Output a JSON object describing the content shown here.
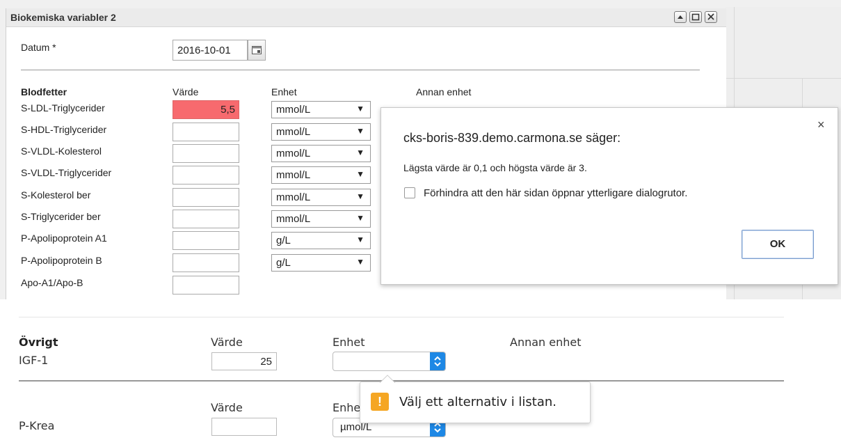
{
  "window": {
    "title": "Biokemiska variabler 2"
  },
  "date": {
    "label": "Datum *",
    "value": "2016-10-01"
  },
  "blood_lipids": {
    "heading": "Blodfetter",
    "col_value": "Värde",
    "col_unit": "Enhet",
    "col_other_unit": "Annan enhet",
    "rows": [
      {
        "label": "S-LDL-Triglycerider",
        "value": "5,5",
        "unit": "mmol/L"
      },
      {
        "label": "S-HDL-Triglycerider",
        "value": "",
        "unit": "mmol/L"
      },
      {
        "label": "S-VLDL-Kolesterol",
        "value": "",
        "unit": "mmol/L"
      },
      {
        "label": "S-VLDL-Triglycerider",
        "value": "",
        "unit": "mmol/L"
      },
      {
        "label": "S-Kolesterol ber",
        "value": "",
        "unit": "mmol/L"
      },
      {
        "label": "S-Triglycerider ber",
        "value": "",
        "unit": "mmol/L"
      },
      {
        "label": "P-Apolipoprotein A1",
        "value": "",
        "unit": "g/L"
      },
      {
        "label": "P-Apolipoprotein B",
        "value": "",
        "unit": "g/L"
      },
      {
        "label": "Apo-A1/Apo-B",
        "value": ""
      }
    ]
  },
  "dialog": {
    "title": "cks-boris-839.demo.carmona.se säger:",
    "message": "Lägsta värde är 0,1 och högsta värde är 3.",
    "checkbox_label": "Förhindra att den här sidan öppnar ytterligare dialogrutor.",
    "ok_label": "OK",
    "close": "×"
  },
  "other": {
    "heading": "Övrigt",
    "col_value": "Värde",
    "col_unit": "Enhet",
    "col_other_unit": "Annan enhet",
    "igf_label": "IGF-1",
    "igf_value": "25",
    "igf_unit": ""
  },
  "krea": {
    "col_value": "Värde",
    "col_unit": "Enhe",
    "label": "P-Krea",
    "value": "",
    "unit": "µmol/L"
  },
  "tooltip": {
    "icon": "!",
    "text": "Välj ett alternativ i listan."
  },
  "colors": {
    "error": "#f76a6e",
    "warning": "#f5a623",
    "spinner": "#1e88e5"
  }
}
